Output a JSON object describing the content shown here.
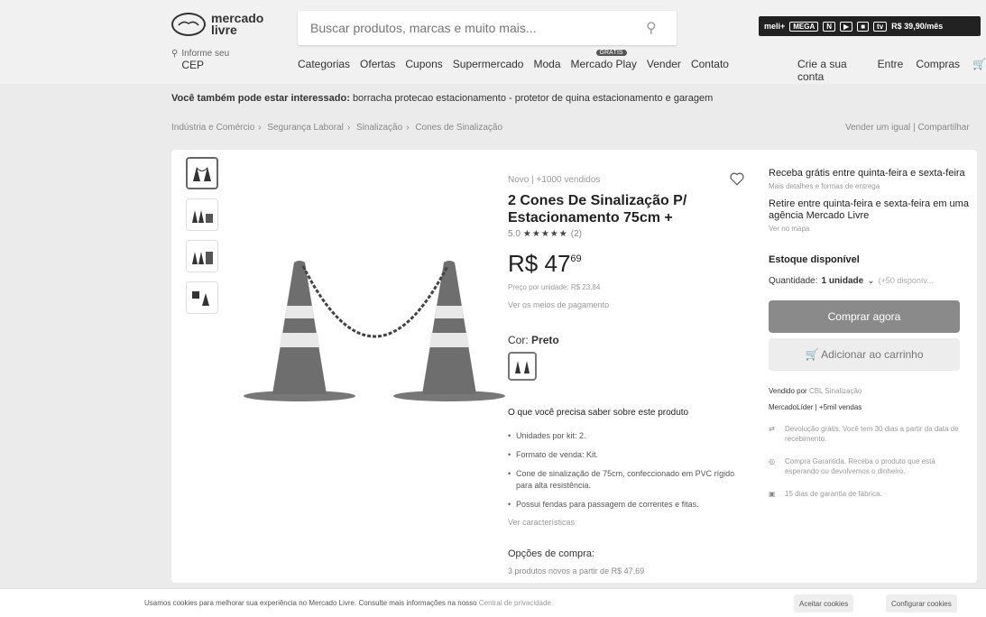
{
  "header": {
    "logo_text": "mercado\nlivre",
    "search_placeholder": "Buscar produtos, marcas e muito mais...",
    "promo": {
      "brand": "meli+",
      "tag": "MEGA",
      "price": "R$ 39,90/mês"
    },
    "location_label": "Informe seu",
    "location_value": "CEP",
    "nav": [
      "Categorias",
      "Ofertas",
      "Cupons",
      "Supermercado",
      "Moda",
      "Mercado Play",
      "Vender",
      "Contato"
    ],
    "play_tag": "GRÁTIS",
    "account": [
      "Crie a sua conta",
      "Entre",
      "Compras"
    ]
  },
  "related": {
    "label": "Você também pode estar interessado:",
    "text": "borracha protecao estacionamento - protetor de quina estacionamento e garagem"
  },
  "breadcrumb": [
    "Indústria e Comércio",
    "Segurança Laboral",
    "Sinalização",
    "Cones de Sinalização"
  ],
  "sell_links": {
    "sell": "Vender um igual",
    "share": "Compartilhar"
  },
  "product": {
    "condition": "Novo | +1000 vendidos",
    "title": "2 Cones De Sinalização P/ Estacionamento 75cm +",
    "rating": "5.0",
    "stars": "★★★★★",
    "reviews": "(2)",
    "price_currency": "R$",
    "price_int": "47",
    "price_cents": "69",
    "unit_price": "Preço por unidade: R$ 23,84",
    "payment_link": "Ver os meios de pagamento",
    "color_label": "Cor:",
    "color_value": "Preto",
    "features_title": "O que você precisa saber sobre este produto",
    "features": [
      "Unidades por kit: 2.",
      "Formato de venda: Kit.",
      "Cone de sinalização de 75cm, confeccionado em PVC rígido para alta resistência.",
      "Possui fendas para passagem de correntes e fitas."
    ],
    "see_characteristics": "Ver características",
    "buy_options": "Opções de compra:",
    "buy_options_sub": "3 produtos novos a partir de R$ 47,69"
  },
  "sidebar": {
    "shipping": "Receba grátis entre quinta-feira e sexta-feira",
    "shipping_more": "Mais detalhes e formas de entrega",
    "pickup": "Retire entre quinta-feira e sexta-feira em uma agência Mercado Livre",
    "pickup_map": "Ver no mapa",
    "stock": "Estoque disponível",
    "qty_label": "Quantidade:",
    "qty_value": "1 unidade",
    "qty_available": "(+50 disponív...",
    "buy_now": "Comprar agora",
    "add_cart": "Adicionar ao carrinho",
    "seller_label": "Vendido por",
    "seller_name": "CBL Sinalização",
    "seller_badge": "MercadoLíder",
    "seller_sales": "+5mil vendas",
    "return": "Devolução grátis. Você tem 30 dias a partir da data de recebimento.",
    "guarantee": "Compra Garantida. Receba o produto que está esperando ou devolvemos o dinheiro.",
    "warranty": "15 dias de garantia de fábrica."
  },
  "cookie": {
    "message": "Usamos cookies para melhorar sua experiência no Mercado Livre. Consulte mais informações na nosso",
    "link": "Central de privacidade.",
    "accept": "Aceitar cookies",
    "configure": "Configurar cookies"
  }
}
